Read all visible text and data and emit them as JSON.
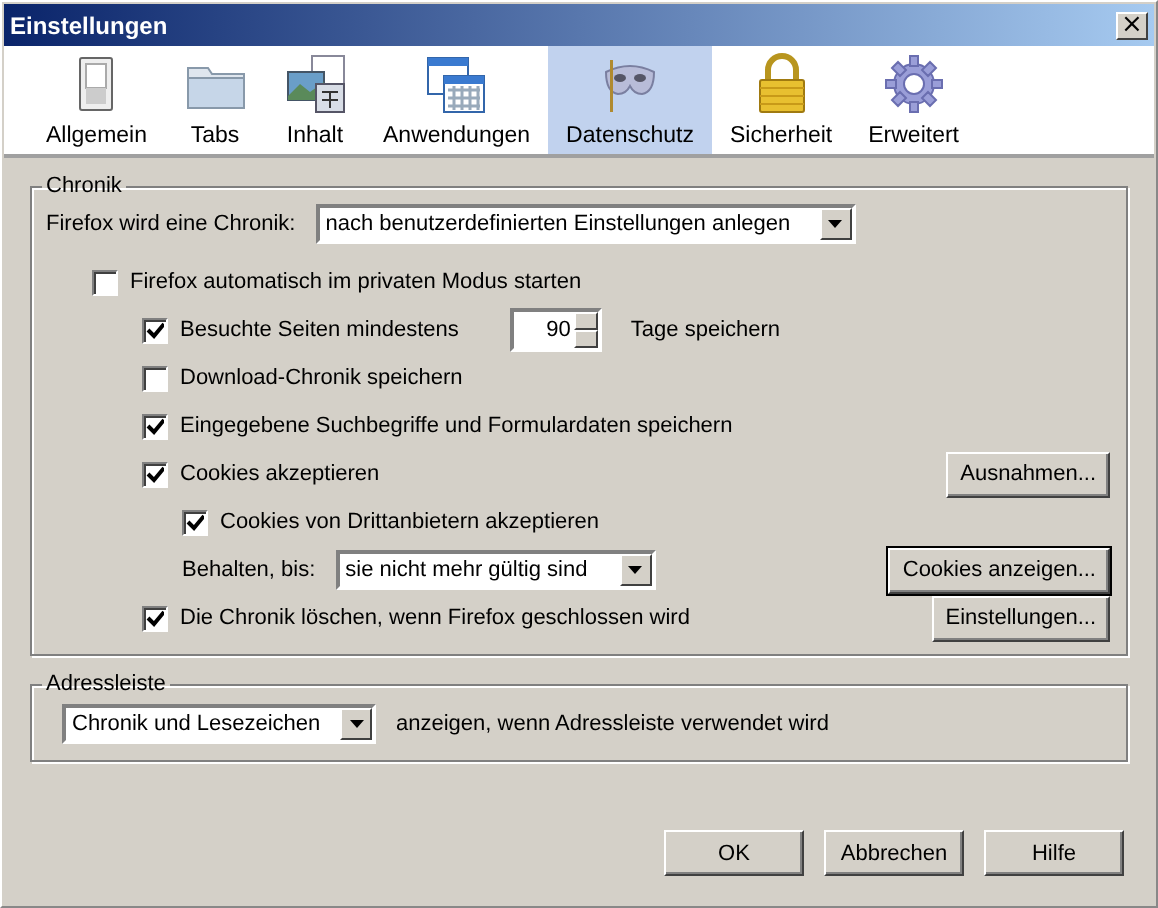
{
  "window": {
    "title": "Einstellungen",
    "close": "×"
  },
  "tabs": [
    {
      "label": "Allgemein",
      "kind": "switch",
      "selected": false
    },
    {
      "label": "Tabs",
      "kind": "folder",
      "selected": false
    },
    {
      "label": "Inhalt",
      "kind": "content",
      "selected": false
    },
    {
      "label": "Anwendungen",
      "kind": "windows",
      "selected": false
    },
    {
      "label": "Datenschutz",
      "kind": "mask",
      "selected": true
    },
    {
      "label": "Sicherheit",
      "kind": "lock",
      "selected": false
    },
    {
      "label": "Erweitert",
      "kind": "gear",
      "selected": false
    }
  ],
  "history": {
    "legend": "Chronik",
    "mode_label": "Firefox wird eine Chronik:",
    "mode_value": "nach benutzerdefinierten Einstellungen anlegen",
    "options": [
      {
        "kind": "checkbox",
        "label": "Firefox automatisch im privaten Modus starten",
        "checked": false,
        "children": [
          {
            "kind": "checkbox",
            "label": "Besuchte Seiten mindestens",
            "checked": true,
            "spinner": "90",
            "suffix": "Tage speichern"
          },
          {
            "kind": "checkbox",
            "label": "Download-Chronik speichern",
            "checked": false
          },
          {
            "kind": "checkbox",
            "label": "Eingegebene Suchbegriffe und Formulardaten speichern",
            "checked": true
          },
          {
            "kind": "checkbox",
            "label": "Cookies akzeptieren",
            "checked": true,
            "button": "Ausnahmen...",
            "children": [
              {
                "kind": "checkbox",
                "label": "Cookies von Drittanbietern akzeptieren",
                "checked": true
              },
              {
                "kind": "select",
                "label": "Behalten, bis:",
                "value": "sie nicht mehr gültig sind",
                "button": "Cookies anzeigen...",
                "button_default": true
              }
            ]
          },
          {
            "kind": "checkbox",
            "label": "Die Chronik löschen, wenn Firefox geschlossen wird",
            "checked": true,
            "button": "Einstellungen..."
          }
        ]
      }
    ]
  },
  "address_bar": {
    "legend": "Adressleiste",
    "value": "Chronik und Lesezeichen",
    "text": "anzeigen, wenn Adressleiste verwendet wird"
  },
  "buttons": [
    "OK",
    "Abbrechen",
    "Hilfe"
  ]
}
